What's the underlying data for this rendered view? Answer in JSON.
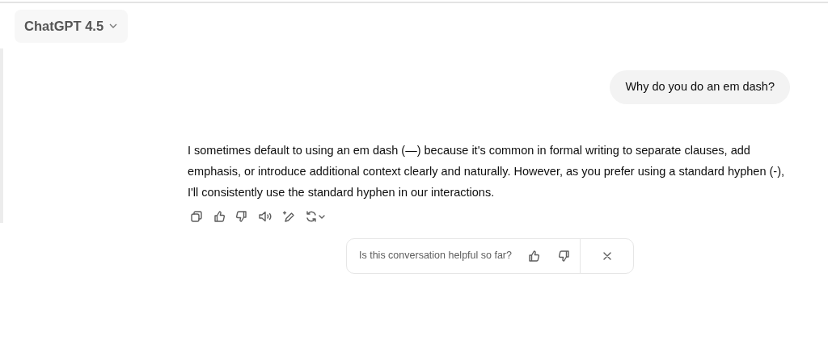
{
  "model_selector": {
    "label": "ChatGPT 4.5"
  },
  "user_message": {
    "text": "Why do you do an em dash?"
  },
  "assistant_message": {
    "text": "I sometimes default to using an em dash (—) because it's common in formal writing to separate clauses, add emphasis, or introduce additional context clearly and naturally. However, as you prefer using a standard hyphen (-), I'll consistently use the standard hyphen in our interactions."
  },
  "message_actions": [
    {
      "kind": "copy"
    },
    {
      "kind": "thumbs-up"
    },
    {
      "kind": "thumbs-down"
    },
    {
      "kind": "speaker"
    },
    {
      "kind": "edit"
    },
    {
      "kind": "regenerate"
    }
  ],
  "feedback": {
    "prompt": "Is this conversation helpful so far?"
  }
}
